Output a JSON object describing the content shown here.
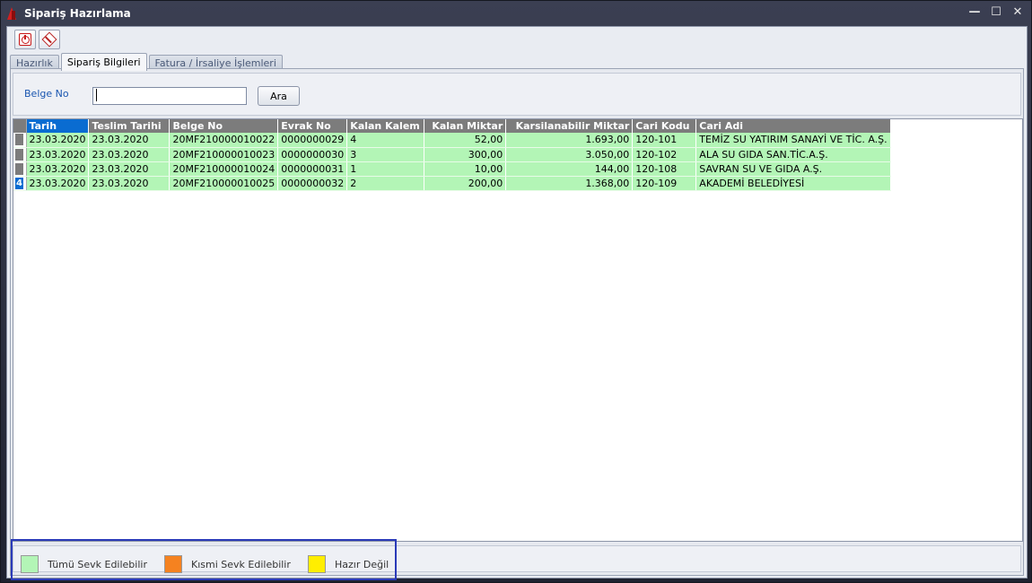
{
  "window": {
    "title": "Sipariş Hazırlama"
  },
  "tabs": [
    {
      "label": "Hazırlık"
    },
    {
      "label": "Sipariş Bilgileri"
    },
    {
      "label": "Fatura / İrsaliye İşlemleri"
    }
  ],
  "search": {
    "label": "Belge No",
    "value": "",
    "button_label": "Ara"
  },
  "grid": {
    "columns": [
      "Tarih",
      "Teslim Tarihi",
      "Belge No",
      "Evrak No",
      "Kalan Kalem",
      "Kalan Miktar",
      "Karsilanabilir Miktar",
      "Cari Kodu",
      "Cari Adi"
    ],
    "rows": [
      [
        "23.03.2020",
        "23.03.2020",
        "20MF210000010022",
        "0000000029",
        "4",
        "52,00",
        "1.693,00",
        "120-101",
        "TEMİZ SU YATIRIM SANAYİ VE TİC. A.Ş."
      ],
      [
        "23.03.2020",
        "23.03.2020",
        "20MF210000010023",
        "0000000030",
        "3",
        "300,00",
        "3.050,00",
        "120-102",
        "ALA SU GIDA SAN.TİC.A.Ş."
      ],
      [
        "23.03.2020",
        "23.03.2020",
        "20MF210000010024",
        "0000000031",
        "1",
        "10,00",
        "144,00",
        "120-108",
        "SAVRAN SU VE GIDA A.Ş."
      ],
      [
        "23.03.2020",
        "23.03.2020",
        "20MF210000010025",
        "0000000032",
        "2",
        "200,00",
        "1.368,00",
        "120-109",
        "AKADEMİ BELEDİYESİ"
      ]
    ],
    "current_row_indicator": "4",
    "row_color": "#b3f5b6"
  },
  "legend": [
    {
      "label": "Tümü Sevk Edilebilir",
      "color": "#b3f5b6"
    },
    {
      "label": "Kısmi Sevk Edilebilir",
      "color": "#f58220"
    },
    {
      "label": "Hazır Değil",
      "color": "#ffee00"
    }
  ],
  "icons": [
    "power-icon",
    "eraser-icon",
    "minimize-icon",
    "maximize-icon",
    "close-icon"
  ]
}
